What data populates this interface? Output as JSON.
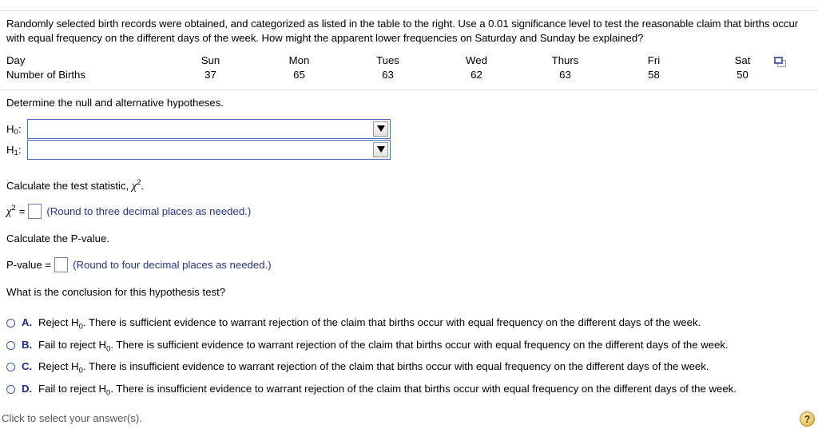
{
  "prompt": {
    "text": "Randomly selected birth records were obtained, and categorized as listed in the table to the right. Use a 0.01 significance level to test the reasonable claim that births occur with equal frequency on the different days of the week. How might the apparent lower frequencies on Saturday and Sunday be explained?"
  },
  "table": {
    "row_labels": [
      "Day",
      "Number of Births"
    ],
    "days": [
      "Sun",
      "Mon",
      "Tues",
      "Wed",
      "Thurs",
      "Fri",
      "Sat"
    ],
    "births": [
      "37",
      "65",
      "63",
      "62",
      "63",
      "58",
      "50"
    ],
    "popout_icon": "open-in-new-window-icon"
  },
  "hypotheses": {
    "instruction": "Determine the null and alternative hypotheses.",
    "h0_label": "H",
    "h0_sub": "0",
    "h0_colon": ":",
    "h0_value": "",
    "h1_label": "H",
    "h1_sub": "1",
    "h1_colon": ":",
    "h1_value": "",
    "dropdown_icon": "chevron-down-icon"
  },
  "test_statistic": {
    "instruction_lead": "Calculate the test statistic, ",
    "instruction_symbol": "χ",
    "instruction_sup": "2",
    "instruction_end": ".",
    "equation_symbol": "χ",
    "equation_sup": "2",
    "equation_equals": "=",
    "value": "",
    "hint": "(Round to three decimal places as needed.)"
  },
  "p_value": {
    "instruction": "Calculate the P-value.",
    "label": "P-value =",
    "value": "",
    "hint": "(Round to four decimal places as needed.)"
  },
  "conclusion": {
    "question": "What is the conclusion for this hypothesis test?",
    "options": [
      {
        "letter": "A.",
        "lead": "Reject H",
        "sub": "0",
        "rest": ". There is sufficient evidence to warrant rejection of the claim that births occur with equal frequency on the different days of the week.",
        "selected": false
      },
      {
        "letter": "B.",
        "lead": "Fail to reject H",
        "sub": "0",
        "rest": ". There is sufficient evidence to warrant rejection of the claim that births occur with equal frequency on the different days of the week.",
        "selected": false
      },
      {
        "letter": "C.",
        "lead": "Reject H",
        "sub": "0",
        "rest": ". There is insufficient evidence to warrant rejection of the claim that births occur with equal frequency on the different days of the week.",
        "selected": false
      },
      {
        "letter": "D.",
        "lead": "Fail to reject H",
        "sub": "0",
        "rest": ". There is insufficient evidence to warrant rejection of the claim that births occur with equal frequency on the different days of the week.",
        "selected": false
      }
    ]
  },
  "status_bar": {
    "text": "Click to select your answer(s).",
    "help_label": "?",
    "help_icon": "question-mark-icon"
  },
  "colors": {
    "link_blue": "#26348b",
    "choice_letter_blue": "#1b2a8c",
    "select_border": "#4a6fc0",
    "input_border": "#6f83b6",
    "divider": "#d9dde2",
    "help_gold": "#f2d279",
    "status_gray": "#565656"
  }
}
